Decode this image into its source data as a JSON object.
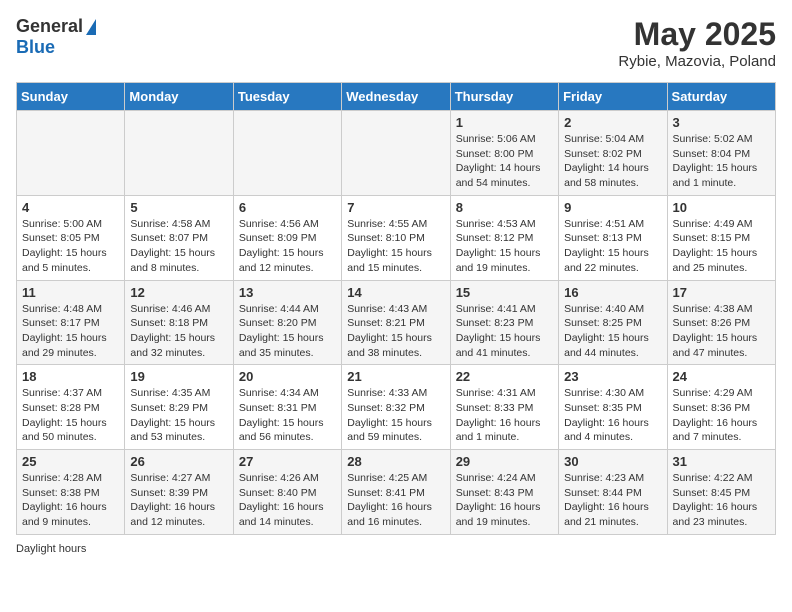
{
  "header": {
    "logo_general": "General",
    "logo_blue": "Blue",
    "title": "May 2025",
    "subtitle": "Rybie, Mazovia, Poland"
  },
  "days_of_week": [
    "Sunday",
    "Monday",
    "Tuesday",
    "Wednesday",
    "Thursday",
    "Friday",
    "Saturday"
  ],
  "weeks": [
    [
      {
        "day": "",
        "info": ""
      },
      {
        "day": "",
        "info": ""
      },
      {
        "day": "",
        "info": ""
      },
      {
        "day": "",
        "info": ""
      },
      {
        "day": "1",
        "info": "Sunrise: 5:06 AM\nSunset: 8:00 PM\nDaylight: 14 hours and 54 minutes."
      },
      {
        "day": "2",
        "info": "Sunrise: 5:04 AM\nSunset: 8:02 PM\nDaylight: 14 hours and 58 minutes."
      },
      {
        "day": "3",
        "info": "Sunrise: 5:02 AM\nSunset: 8:04 PM\nDaylight: 15 hours and 1 minute."
      }
    ],
    [
      {
        "day": "4",
        "info": "Sunrise: 5:00 AM\nSunset: 8:05 PM\nDaylight: 15 hours and 5 minutes."
      },
      {
        "day": "5",
        "info": "Sunrise: 4:58 AM\nSunset: 8:07 PM\nDaylight: 15 hours and 8 minutes."
      },
      {
        "day": "6",
        "info": "Sunrise: 4:56 AM\nSunset: 8:09 PM\nDaylight: 15 hours and 12 minutes."
      },
      {
        "day": "7",
        "info": "Sunrise: 4:55 AM\nSunset: 8:10 PM\nDaylight: 15 hours and 15 minutes."
      },
      {
        "day": "8",
        "info": "Sunrise: 4:53 AM\nSunset: 8:12 PM\nDaylight: 15 hours and 19 minutes."
      },
      {
        "day": "9",
        "info": "Sunrise: 4:51 AM\nSunset: 8:13 PM\nDaylight: 15 hours and 22 minutes."
      },
      {
        "day": "10",
        "info": "Sunrise: 4:49 AM\nSunset: 8:15 PM\nDaylight: 15 hours and 25 minutes."
      }
    ],
    [
      {
        "day": "11",
        "info": "Sunrise: 4:48 AM\nSunset: 8:17 PM\nDaylight: 15 hours and 29 minutes."
      },
      {
        "day": "12",
        "info": "Sunrise: 4:46 AM\nSunset: 8:18 PM\nDaylight: 15 hours and 32 minutes."
      },
      {
        "day": "13",
        "info": "Sunrise: 4:44 AM\nSunset: 8:20 PM\nDaylight: 15 hours and 35 minutes."
      },
      {
        "day": "14",
        "info": "Sunrise: 4:43 AM\nSunset: 8:21 PM\nDaylight: 15 hours and 38 minutes."
      },
      {
        "day": "15",
        "info": "Sunrise: 4:41 AM\nSunset: 8:23 PM\nDaylight: 15 hours and 41 minutes."
      },
      {
        "day": "16",
        "info": "Sunrise: 4:40 AM\nSunset: 8:25 PM\nDaylight: 15 hours and 44 minutes."
      },
      {
        "day": "17",
        "info": "Sunrise: 4:38 AM\nSunset: 8:26 PM\nDaylight: 15 hours and 47 minutes."
      }
    ],
    [
      {
        "day": "18",
        "info": "Sunrise: 4:37 AM\nSunset: 8:28 PM\nDaylight: 15 hours and 50 minutes."
      },
      {
        "day": "19",
        "info": "Sunrise: 4:35 AM\nSunset: 8:29 PM\nDaylight: 15 hours and 53 minutes."
      },
      {
        "day": "20",
        "info": "Sunrise: 4:34 AM\nSunset: 8:31 PM\nDaylight: 15 hours and 56 minutes."
      },
      {
        "day": "21",
        "info": "Sunrise: 4:33 AM\nSunset: 8:32 PM\nDaylight: 15 hours and 59 minutes."
      },
      {
        "day": "22",
        "info": "Sunrise: 4:31 AM\nSunset: 8:33 PM\nDaylight: 16 hours and 1 minute."
      },
      {
        "day": "23",
        "info": "Sunrise: 4:30 AM\nSunset: 8:35 PM\nDaylight: 16 hours and 4 minutes."
      },
      {
        "day": "24",
        "info": "Sunrise: 4:29 AM\nSunset: 8:36 PM\nDaylight: 16 hours and 7 minutes."
      }
    ],
    [
      {
        "day": "25",
        "info": "Sunrise: 4:28 AM\nSunset: 8:38 PM\nDaylight: 16 hours and 9 minutes."
      },
      {
        "day": "26",
        "info": "Sunrise: 4:27 AM\nSunset: 8:39 PM\nDaylight: 16 hours and 12 minutes."
      },
      {
        "day": "27",
        "info": "Sunrise: 4:26 AM\nSunset: 8:40 PM\nDaylight: 16 hours and 14 minutes."
      },
      {
        "day": "28",
        "info": "Sunrise: 4:25 AM\nSunset: 8:41 PM\nDaylight: 16 hours and 16 minutes."
      },
      {
        "day": "29",
        "info": "Sunrise: 4:24 AM\nSunset: 8:43 PM\nDaylight: 16 hours and 19 minutes."
      },
      {
        "day": "30",
        "info": "Sunrise: 4:23 AM\nSunset: 8:44 PM\nDaylight: 16 hours and 21 minutes."
      },
      {
        "day": "31",
        "info": "Sunrise: 4:22 AM\nSunset: 8:45 PM\nDaylight: 16 hours and 23 minutes."
      }
    ]
  ],
  "footer": {
    "daylight_label": "Daylight hours"
  }
}
